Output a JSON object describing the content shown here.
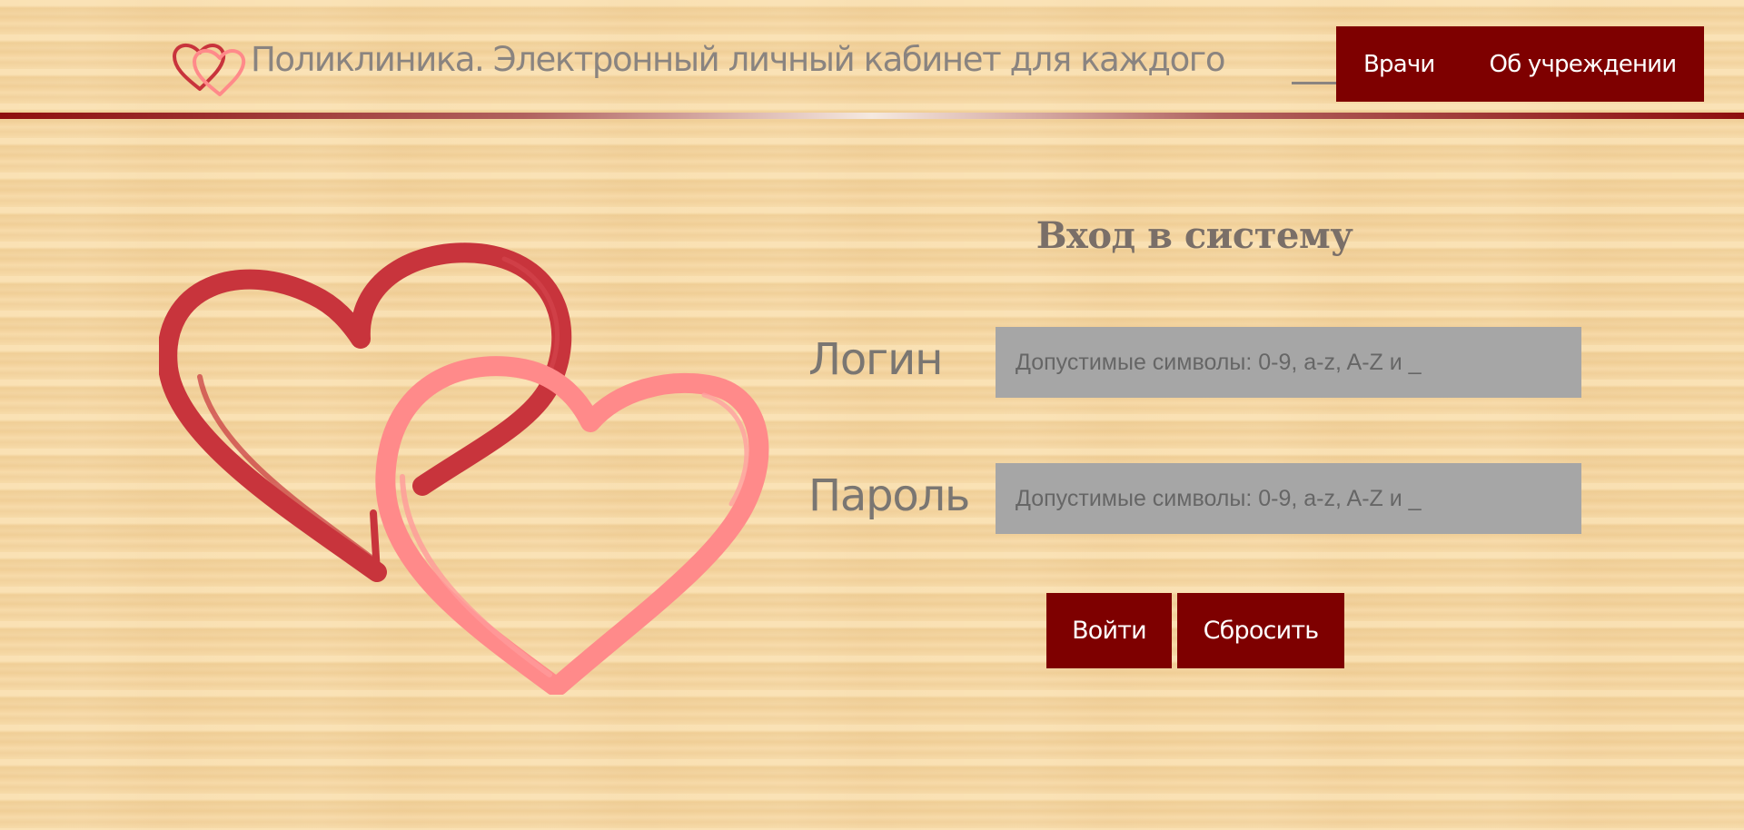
{
  "header": {
    "logo_icon": "double-heart-icon",
    "title": "Поликлиника. Электронный личный кабинет для каждого",
    "nav": [
      {
        "label": "Врачи"
      },
      {
        "label": "Об учреждении"
      }
    ]
  },
  "illustration": {
    "icon": "two-hearts-illustration",
    "colors": {
      "dark_heart": "#c8343c",
      "light_heart": "#ff8a8a"
    }
  },
  "login": {
    "title": "Вход в систему",
    "login_label": "Логин",
    "login_value": "",
    "login_placeholder": "Допустимые символы: 0-9, a-z, A-Z и _",
    "password_label": "Пароль",
    "password_value": "",
    "password_placeholder": "Допустимые символы: 0-9, a-z, A-Z и _",
    "submit_label": "Войти",
    "reset_label": "Сбросить"
  },
  "colors": {
    "accent": "#7e0000",
    "background": "#f3d4a0",
    "input_bg": "#a6a6a6",
    "text_muted": "#8a8480"
  }
}
